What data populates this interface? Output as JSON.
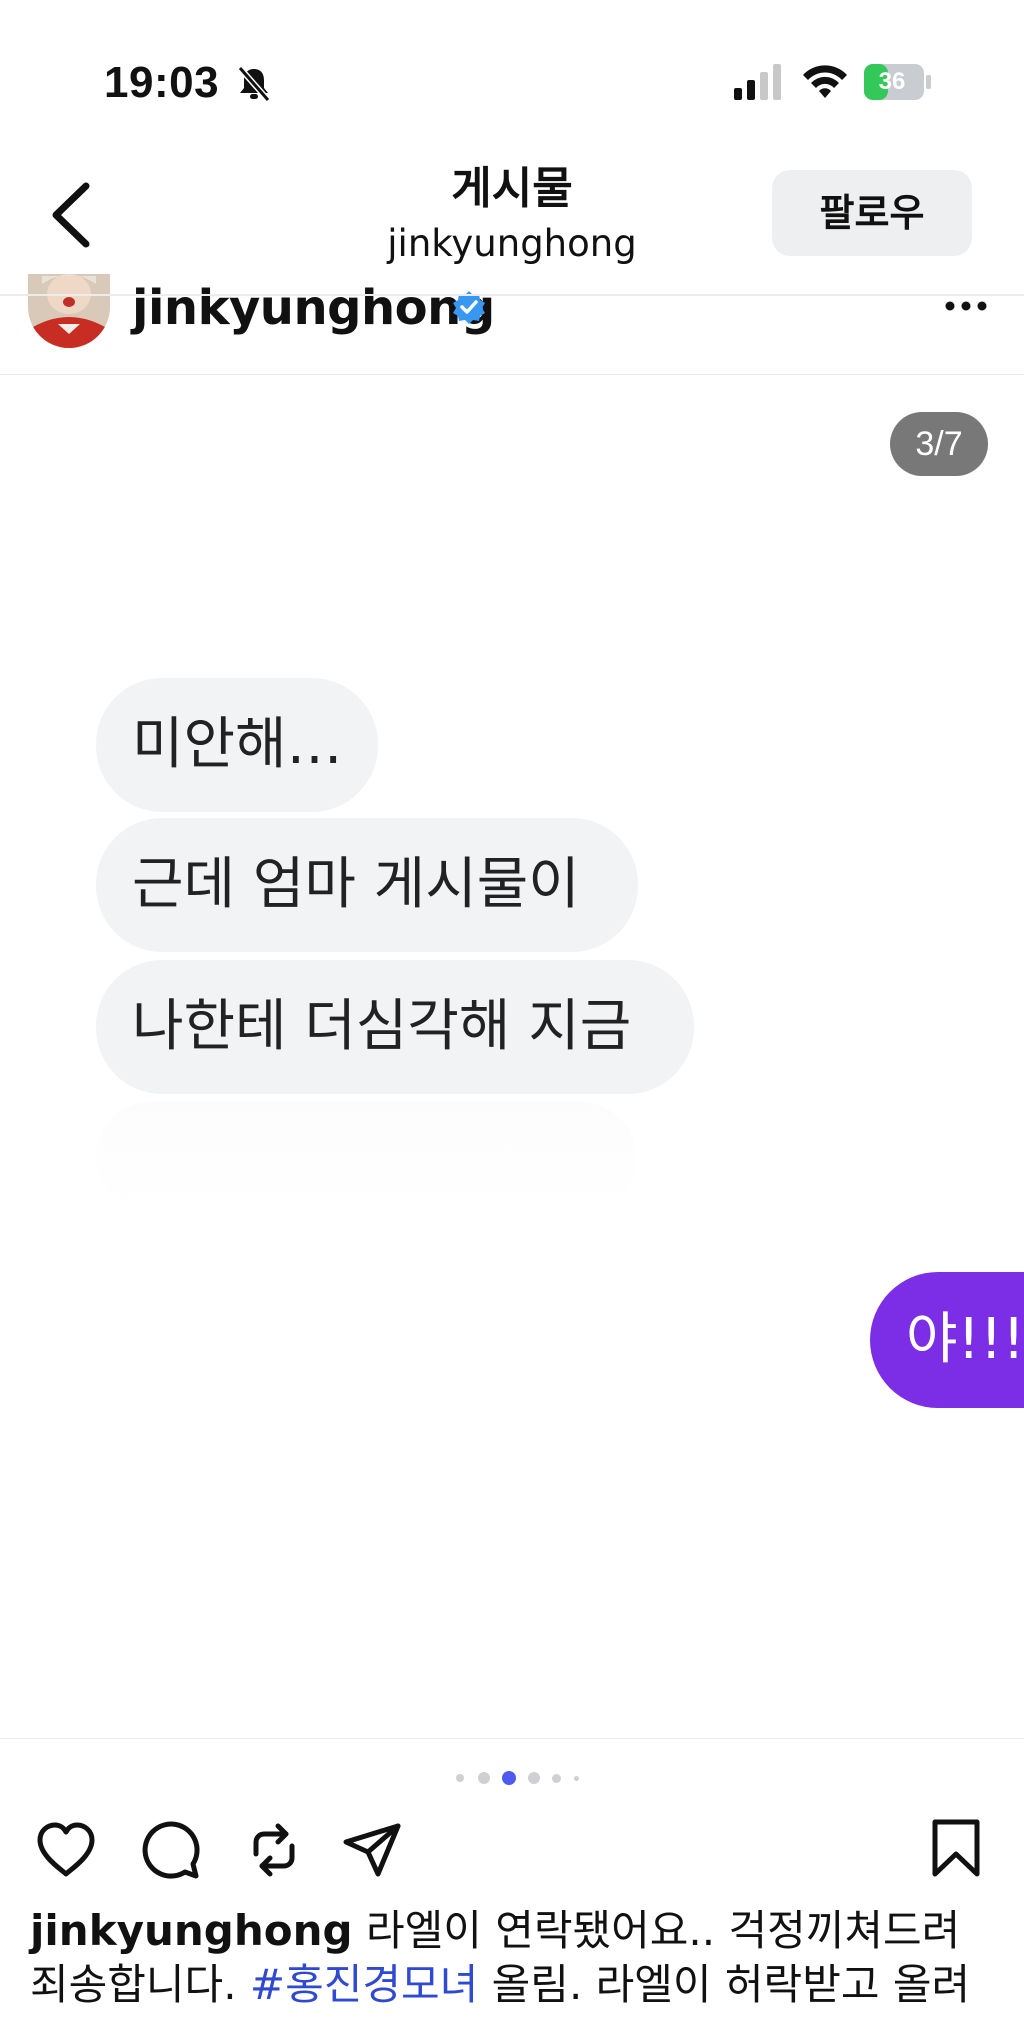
{
  "status_bar": {
    "time": "19:03",
    "battery": "36"
  },
  "nav": {
    "title": "게시물",
    "subtitle": "jinkyunghong",
    "follow_label": "팔로우"
  },
  "post": {
    "username": "jinkyunghong"
  },
  "carousel": {
    "counter": "3/7",
    "total": 7,
    "active_index": 3
  },
  "messages": {
    "received": [
      "미안해…",
      "근데 엄마 게시물이",
      "나한테 더심각해 지금"
    ],
    "sent": "야!!!"
  },
  "caption": {
    "username": "jinkyunghong",
    "text_1": " 라엘이 연락됐어요.. 걱정끼쳐드려 죄송합니다. ",
    "hashtag": "#홍진경모녀",
    "text_2": " 올림. 라엘이 허락받고 올려"
  },
  "colors": {
    "accent_purple": "#7b2ee6",
    "hashtag_blue": "#2f49d1",
    "verified_blue": "#3897f0"
  },
  "icons": [
    "bell-slash-icon",
    "signal-icon",
    "wifi-icon",
    "battery-icon",
    "back-icon",
    "verified-icon",
    "more-icon",
    "heart-icon",
    "comment-icon",
    "repost-icon",
    "share-icon",
    "bookmark-icon"
  ]
}
